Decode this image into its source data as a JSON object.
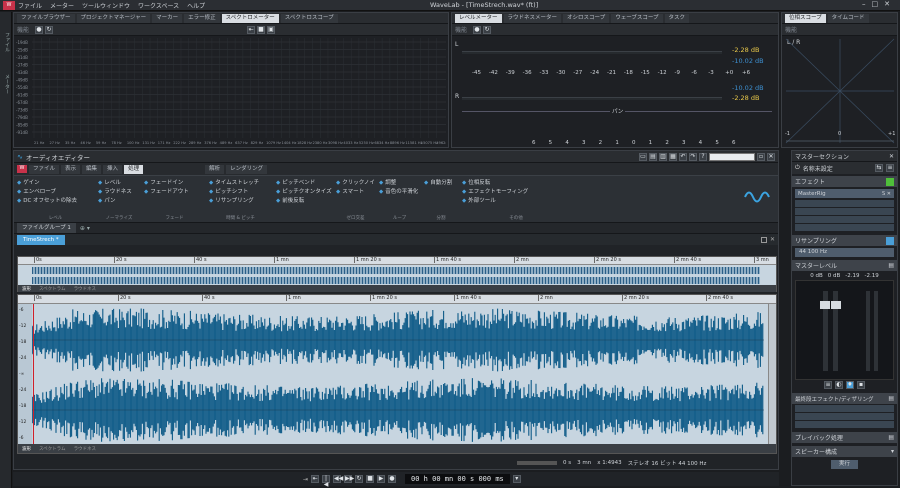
{
  "app": {
    "menus": [
      "ファイル",
      "メーター",
      "ツールウィンドウ",
      "ワークスペース",
      "ヘルプ"
    ],
    "title": "WaveLab - [TimeStrech.wav* (ft)]"
  },
  "left_strip": {
    "items": [
      "ファイル",
      "メーター"
    ]
  },
  "top_left": {
    "tabs": [
      "ファイルブラウザー",
      "プロジェクトマネージャー",
      "マーカー",
      "エラー修正",
      "スペクトロメーター",
      "スペクトロスコープ"
    ],
    "active": 4,
    "options": "機能",
    "y_ticks": [
      "-19dB",
      "-25dB",
      "-31dB",
      "-37dB",
      "-43dB",
      "-49dB",
      "-55dB",
      "-61dB",
      "-67dB",
      "-73dB",
      "-79dB",
      "-85dB",
      "-91dB"
    ],
    "x_ticks": [
      "21 Hz",
      "24 Hz",
      "27 Hz",
      "31 Hz",
      "35 Hz",
      "40 Hz",
      "46 Hz",
      "52 Hz",
      "59 Hz",
      "68 Hz",
      "78 Hz",
      "88 Hz",
      "100 Hz",
      "115 Hz",
      "131 Hz",
      "149 Hz",
      "171 Hz",
      "195 Hz",
      "222 Hz",
      "253 Hz",
      "289 Hz",
      "330 Hz",
      "376 Hz",
      "429 Hz",
      "489 Hz",
      "558 Hz",
      "637 Hz",
      "727 Hz",
      "829 Hz",
      "946 Hz",
      "1079 Hz",
      "1231 Hz",
      "1404 Hz",
      "1602 Hz",
      "1828 Hz",
      "2086 Hz",
      "2380 Hz",
      "2715 Hz",
      "3098 Hz",
      "3534 Hz",
      "4033 Hz",
      "4601 Hz",
      "5250 Hz",
      "5990 Hz",
      "6834 Hz",
      "7797 Hz",
      "8896 Hz",
      "10150 Hz",
      "11581 Hz",
      "13213 Hz",
      "15075 Hz",
      "17200 Hz",
      "19624 Hz"
    ]
  },
  "top_mid": {
    "tabs": [
      "レベルメーター",
      "ラウドネスメーター",
      "オシロスコープ",
      "ウェーブスコープ",
      "タスク"
    ],
    "active": 0,
    "options": "機能",
    "readouts": [
      "-2.28 dB",
      "-10.02 dB",
      "-10.02 dB",
      "-2.28 dB"
    ],
    "scale": [
      "-45",
      "-42",
      "-39",
      "-36",
      "-33",
      "-30",
      "-27",
      "-24",
      "-21",
      "-18",
      "-15",
      "-12",
      "-9",
      "-6",
      "-3",
      "+0",
      "+6"
    ],
    "pan_label": "パン",
    "bottom_scale": [
      "6",
      "5",
      "4",
      "3",
      "2",
      "1",
      "0",
      "1",
      "2",
      "3",
      "4",
      "5",
      "6"
    ],
    "lr": [
      "L",
      "R"
    ]
  },
  "top_right": {
    "tabs": [
      "位相スコープ",
      "タイムコード"
    ],
    "active": 0,
    "options": "機能",
    "label": "L / R",
    "axis": [
      "-1",
      "0",
      "+1"
    ]
  },
  "editor": {
    "title": "オーディオエディター",
    "tabs": [
      "ファイル",
      "表示",
      "編集",
      "挿入",
      "処理",
      "解析",
      "レンダリング"
    ],
    "active": 4,
    "groups": [
      {
        "name": "レベル",
        "items": [
          "ゲイン",
          "エンベロープ",
          "DC オフセットの除去"
        ]
      },
      {
        "name": "ノーマライズ",
        "items": [
          "レベル",
          "ラウドネス",
          "パン"
        ]
      },
      {
        "name": "フェード",
        "items": [
          "フェードイン",
          "フェードアウト"
        ]
      },
      {
        "name": "時間 & ピッチ",
        "items": [
          "タイムストレッチ",
          "ピッチシフト",
          "リサンプリング"
        ]
      },
      {
        "name": "",
        "items": [
          "ピッチベンド",
          "ピッチクオンタイズ",
          "前後反転"
        ]
      },
      {
        "name": "ゼロ交差",
        "items": [
          "クリックノイズ",
          "スマート"
        ]
      },
      {
        "name": "ループ",
        "items": [
          "調整",
          "音色の平滑化"
        ]
      },
      {
        "name": "分割",
        "items": [
          "自動分割"
        ]
      },
      {
        "name": "その他",
        "items": [
          "位相反転",
          "エフェクトモーフィング",
          "外部ツール"
        ]
      }
    ],
    "file_group": "ファイルグループ 1",
    "file_tab": "TimeStrech *",
    "overview_ticks": [
      "0s",
      "20 s",
      "40 s",
      "1 mn",
      "1 mn 20 s",
      "1 mn 40 s",
      "2 mn",
      "2 mn 20 s",
      "2 mn 40 s",
      "3 mn"
    ],
    "main_ticks": [
      "0s",
      "20 s",
      "40 s",
      "1 mn",
      "1 mn 20 s",
      "1 mn 40 s",
      "2 mn",
      "2 mn 20 s",
      "2 mn 40 s"
    ],
    "view_tabs": [
      "波形",
      "スペクトラム",
      "ラウドネス"
    ],
    "status": {
      "start": "0 s",
      "end": "3 mn",
      "zoom": "x 1:4943",
      "format": "ステレオ 16 ビット 44 100 Hz"
    },
    "db_ticks": [
      "-6",
      "-12",
      "-18",
      "-24",
      "-∞",
      "-24",
      "-18",
      "-12",
      "-6"
    ]
  },
  "transport": {
    "time": "00 h 00 mn 00 s 000 ms"
  },
  "master": {
    "title": "マスターセクション",
    "preset": "名称未設定",
    "effects_label": "エフェクト",
    "plugin": "MasterRig",
    "resampling_label": "リサンプリング",
    "resampling_value": "44 100 Hz",
    "level_label": "マスターレベル",
    "levels": [
      "0 dB",
      "0 dB",
      "-2.19",
      "-2.19"
    ],
    "final_label": "最終段エフェクト/ディザリング",
    "playback_label": "プレイバック処理",
    "speaker_label": "スピーカー構成",
    "run_label": "実行"
  }
}
